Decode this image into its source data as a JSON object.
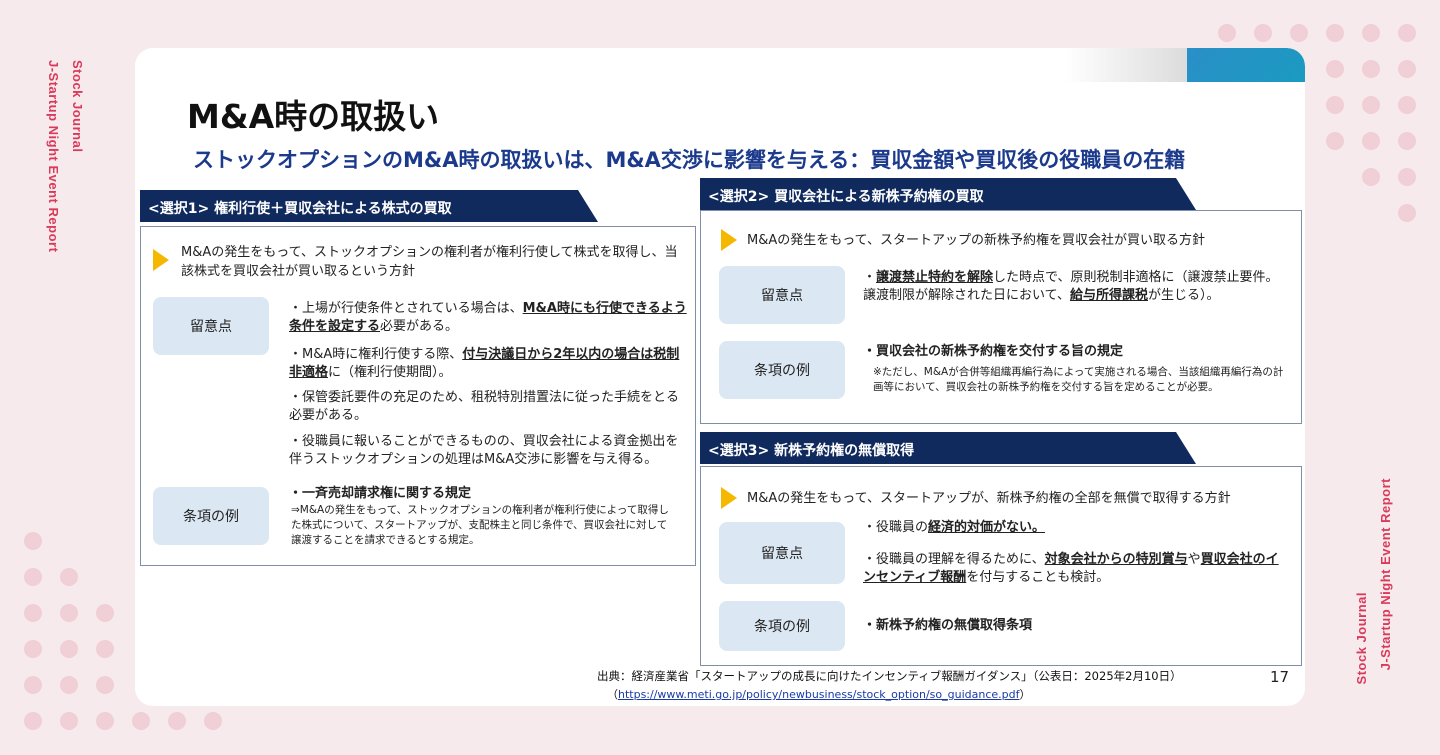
{
  "side": {
    "left_line1": "Stock Journal",
    "left_line2": "J-Startup Night Event Report",
    "right_line1": "Stock Journal",
    "right_line2": "J-Startup Night Event Report"
  },
  "slide": {
    "title": "M&A時の取扱い",
    "subtitle": "ストックオプションのM&A時の取扱いは、M&A交渉に影響を与える：買収金額や買収後の役職員の在籍",
    "option1": {
      "tab": "<選択1> 権利行使＋買収会社による株式の買取",
      "lead": "M&Aの発生をもって、ストックオプションの権利者が権利行使して株式を取得し、当該株式を買収会社が買い取るという方針",
      "pill_notes": "留意点",
      "pill_example": "条項の例",
      "note1_pre": "・上場が行使条件とされている場合は、",
      "note1_em": "M&A時にも行使できるよう条件を設定する",
      "note1_post": "必要がある。",
      "note2_pre": "・M&A時に権利行使する際、",
      "note2_em": "付与決議日から2年以内の場合は税制非適格",
      "note2_post": "に（権利行使期間）。",
      "note3": "・保管委託要件の充足のため、租税特別措置法に従った手続をとる必要がある。",
      "note4": "・役職員に報いることができるものの、買収会社による資金拠出を伴うストックオプションの処理はM&A交渉に影響を与え得る。",
      "example_title": "・一斉売却請求権に関する規定",
      "example_text": "⇒M&Aの発生をもって、ストックオプションの権利者が権利行使によって取得した株式について、スタートアップが、支配株主と同じ条件で、買収会社に対して譲渡することを請求できるとする規定。"
    },
    "option2": {
      "tab": "<選択2> 買収会社による新株予約権の買取",
      "lead": "M&Aの発生をもって、スタートアップの新株予約権を買収会社が買い取る方針",
      "pill_notes": "留意点",
      "pill_example": "条項の例",
      "note_pre": "・",
      "note_em1": "譲渡禁止特約を解除",
      "note_mid": "した時点で、原則税制非適格に（譲渡禁止要件。譲渡制限が解除された日において、",
      "note_em2": "給与所得課税",
      "note_post": "が生じる）。",
      "example_title": "・買収会社の新株予約権を交付する旨の規定",
      "example_text": "※ただし、M&Aが合併等組織再編行為によって実施される場合、当該組織再編行為の計画等において、買収会社の新株予約権を交付する旨を定めることが必要。"
    },
    "option3": {
      "tab": "<選択3> 新株予約権の無償取得",
      "lead": "M&Aの発生をもって、スタートアップが、新株予約権の全部を無償で取得する方針",
      "pill_notes": "留意点",
      "pill_example": "条項の例",
      "note1_pre": "・役職員の",
      "note1_em": "経済的対価がない。",
      "note2_pre": "・役職員の理解を得るために、",
      "note2_em1": "対象会社からの特別賞与",
      "note2_mid": "や",
      "note2_em2": "買収会社のインセンティブ報酬",
      "note2_post": "を付与することも検討。",
      "example_title": "・新株予約権の無償取得条項"
    },
    "source": "出典：経済産業省「スタートアップの成長に向けたインセンティブ報酬ガイダンス」（公表日：2025年2月10日）",
    "url_open": "（",
    "url": "https://www.meti.go.jp/policy/newbusiness/stock_option/so_guidance.pdf",
    "url_close": "）",
    "page_number": "17"
  },
  "colors": {
    "accent_pink": "#d93a5a",
    "navy": "#102a5e",
    "subtitle_blue": "#1b3a8c",
    "pill_bg": "#dbe7f3",
    "arrow_yellow": "#f5b800"
  }
}
